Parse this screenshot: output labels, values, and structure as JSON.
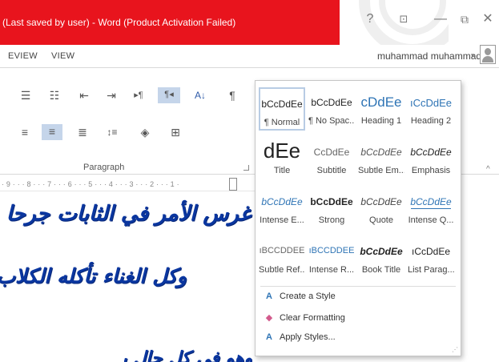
{
  "window": {
    "title": "(Last saved by user) - Word (Product Activation Failed)",
    "controls": {
      "help": "?",
      "ribbon_display": "⊡",
      "minimize": "—",
      "restore": "⧉",
      "close": "✕"
    }
  },
  "tabs": [
    {
      "label": "EVIEW"
    },
    {
      "label": "VIEW"
    }
  ],
  "user": {
    "name": "muhammad muhammad",
    "caret": "▾"
  },
  "ribbon": {
    "group_label": "Paragraph",
    "buttons": [
      {
        "icon": "bullets-icon",
        "glyph": "☰"
      },
      {
        "icon": "numbering-icon",
        "glyph": "☷"
      },
      {
        "icon": "decrease-indent-icon",
        "glyph": "⇤"
      },
      {
        "icon": "increase-indent-icon",
        "glyph": "⇥"
      },
      {
        "icon": "ltr-icon",
        "glyph": "▸¶"
      },
      {
        "icon": "rtl-icon",
        "glyph": "¶◂"
      },
      {
        "icon": "sort-icon",
        "glyph": "A↓"
      },
      {
        "icon": "show-marks-icon",
        "glyph": "¶"
      },
      {
        "icon": "align-left-icon",
        "glyph": "≡"
      },
      {
        "icon": "align-center-icon",
        "glyph": "≡"
      },
      {
        "icon": "justify-icon",
        "glyph": "≣"
      },
      {
        "icon": "line-spacing-icon",
        "glyph": "↕≡"
      },
      {
        "icon": "shading-icon",
        "glyph": "◈"
      },
      {
        "icon": "borders-icon",
        "glyph": "⊞"
      }
    ],
    "collapse_glyph": "^",
    "accent": "#c5d5ea"
  },
  "ruler": {
    "text": "· 9 · · · 8 · · · 7 · · · 6 · · · 5 · · · 4 · · · 3 · · · 2 · · · 1 ·"
  },
  "document": {
    "lines": [
      "غرس الأمر في الثابات جرحا",
      "وكل الغناء تأكله الكلاب",
      "وهو في كل حال يبقى"
    ],
    "text_color": "#0a36a0"
  },
  "styles": [
    {
      "sample": "bCcDdEe",
      "name": "¶ Normal",
      "color": "#222",
      "size": 12,
      "weight": "normal",
      "style": "normal",
      "active": true
    },
    {
      "sample": "bCcDdEe",
      "name": "¶ No Spac...",
      "color": "#222",
      "size": 12,
      "weight": "normal",
      "style": "normal",
      "active": false
    },
    {
      "sample": "cDdEe",
      "name": "Heading 1",
      "color": "#2e74b5",
      "size": 17,
      "weight": "normal",
      "style": "normal",
      "active": false
    },
    {
      "sample": "ıCcDdEe",
      "name": "Heading 2",
      "color": "#2e74b5",
      "size": 13,
      "weight": "normal",
      "style": "normal",
      "active": false
    },
    {
      "sample": "dEe",
      "name": "Title",
      "color": "#222",
      "size": 26,
      "weight": "normal",
      "style": "normal",
      "active": false
    },
    {
      "sample": "CcDdEe",
      "name": "Subtitle",
      "color": "#666",
      "size": 12,
      "weight": "normal",
      "style": "normal",
      "active": false
    },
    {
      "sample": "bCcDdEe",
      "name": "Subtle Em...",
      "color": "#555",
      "size": 12,
      "weight": "normal",
      "style": "italic",
      "active": false
    },
    {
      "sample": "bCcDdEe",
      "name": "Emphasis",
      "color": "#222",
      "size": 12,
      "weight": "normal",
      "style": "italic",
      "active": false
    },
    {
      "sample": "bCcDdEe",
      "name": "Intense E...",
      "color": "#2e74b5",
      "size": 12,
      "weight": "normal",
      "style": "italic",
      "active": false
    },
    {
      "sample": "bCcDdEe",
      "name": "Strong",
      "color": "#222",
      "size": 12,
      "weight": "bold",
      "style": "normal",
      "active": false
    },
    {
      "sample": "bCcDdEe",
      "name": "Quote",
      "color": "#444",
      "size": 12,
      "weight": "normal",
      "style": "italic",
      "active": false
    },
    {
      "sample": "bCcDdEe",
      "name": "Intense Q...",
      "color": "#2e74b5",
      "size": 12,
      "weight": "normal",
      "style": "italic",
      "active": false
    },
    {
      "sample": "ıBCCDDEE",
      "name": "Subtle Ref...",
      "color": "#666",
      "size": 11,
      "weight": "normal",
      "style": "normal",
      "active": false
    },
    {
      "sample": "ıBCCDDEE",
      "name": "Intense R...",
      "color": "#2e74b5",
      "size": 11,
      "weight": "normal",
      "style": "normal",
      "active": false
    },
    {
      "sample": "bCcDdEe",
      "name": "Book Title",
      "color": "#222",
      "size": 12,
      "weight": "bold",
      "style": "italic",
      "active": false
    },
    {
      "sample": "ıCcDdEe",
      "name": "List Parag...",
      "color": "#222",
      "size": 12,
      "weight": "normal",
      "style": "normal",
      "active": false
    }
  ],
  "commands": [
    {
      "icon": "create-style-icon",
      "glyph": "A",
      "label": "Create a Style"
    },
    {
      "icon": "clear-formatting-icon",
      "glyph": "◆",
      "label": "Clear Formatting"
    },
    {
      "icon": "apply-styles-icon",
      "glyph": "A",
      "label": "Apply Styles..."
    }
  ],
  "colors": {
    "title_bar": "#e8141d",
    "style_blue": "#2e74b5"
  }
}
